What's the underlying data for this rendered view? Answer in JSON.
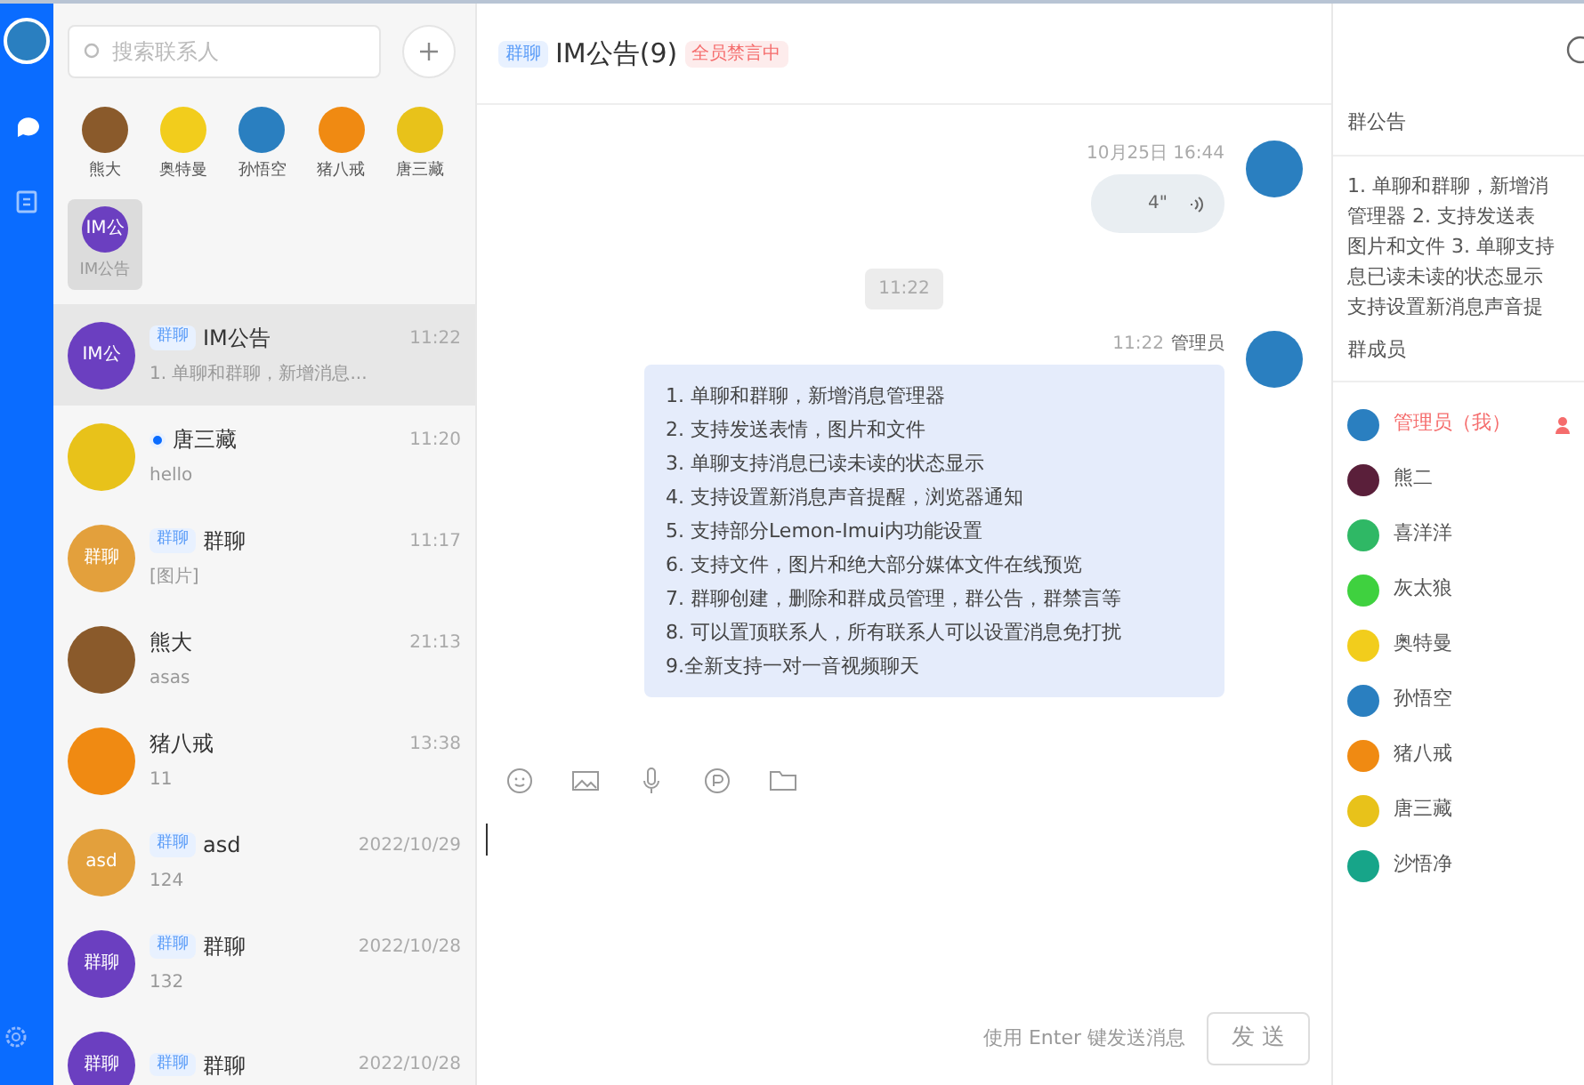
{
  "nav": {
    "items": [
      {
        "kind": "chat",
        "selected": true
      },
      {
        "kind": "contacts",
        "selected": false
      }
    ]
  },
  "search": {
    "placeholder": "搜索联系人"
  },
  "top_contacts": [
    {
      "name": "熊大",
      "color": "#8a5a2b",
      "selected": false
    },
    {
      "name": "奥特曼",
      "color": "#f2cd1c",
      "selected": false
    },
    {
      "name": "孙悟空",
      "color": "#2a7fc0",
      "selected": false
    },
    {
      "name": "猪八戒",
      "color": "#f08a12",
      "selected": false
    },
    {
      "name": "唐三藏",
      "color": "#e8c21a",
      "selected": false
    },
    {
      "name": "IM公告",
      "avatar_text": "IM公",
      "color": "#6b3fc0",
      "selected": true
    }
  ],
  "conversations": [
    {
      "tag": "群聊",
      "name": "IM公告",
      "time": "11:22",
      "preview": "1. 单聊和群聊，新增消息...",
      "avatar_text": "IM公",
      "color": "#6b3fc0",
      "dot": false,
      "selected": true
    },
    {
      "name": "唐三藏",
      "time": "11:20",
      "preview": "hello",
      "color": "#e8c21a",
      "dot": true,
      "selected": false
    },
    {
      "tag": "群聊",
      "name": "群聊",
      "time": "11:17",
      "preview": "[图片]",
      "avatar_text": "群聊",
      "color": "#e3a03c",
      "dot": false,
      "selected": false
    },
    {
      "name": "熊大",
      "time": "21:13",
      "preview": "asas",
      "color": "#8a5a2b",
      "dot": false,
      "selected": false
    },
    {
      "name": "猪八戒",
      "time": "13:38",
      "preview": "11",
      "color": "#f08a12",
      "dot": false,
      "selected": false
    },
    {
      "tag": "群聊",
      "name": "asd",
      "time": "2022/10/29",
      "preview": "124",
      "avatar_text": "asd",
      "color": "#e3a03c",
      "dot": false,
      "selected": false
    },
    {
      "tag": "群聊",
      "name": "群聊",
      "time": "2022/10/28",
      "preview": "132",
      "avatar_text": "群聊",
      "color": "#6b3fc0",
      "dot": false,
      "selected": false
    },
    {
      "tag": "群聊",
      "name": "群聊",
      "time": "2022/10/28",
      "avatar_text": "群聊",
      "color": "#6b3fc0",
      "dot": false,
      "selected": false
    }
  ],
  "header": {
    "tag": "群聊",
    "title": "IM公告(9)",
    "status": "全员禁言中"
  },
  "messages": [
    {
      "kind": "voice",
      "time": "10月25日 16:44",
      "duration": "4\""
    },
    {
      "kind": "divider",
      "time": "11:22"
    },
    {
      "kind": "text",
      "time": "11:22",
      "sender": "管理员",
      "lines": [
        "1. 单聊和群聊，新增消息管理器",
        "2. 支持发送表情，图片和文件",
        "3. 单聊支持消息已读未读的状态显示",
        "4. 支持设置新消息声音提醒，浏览器通知",
        "5. 支持部分Lemon-Imui内功能设置",
        "6. 支持文件，图片和绝大部分媒体文件在线预览",
        "7. 群聊创建，删除和群成员管理，群公告，群禁言等",
        "8. 可以置顶联系人，所有联系人可以设置消息免打扰",
        "9.全新支持一对一音视频聊天"
      ]
    }
  ],
  "toolbar": [
    {
      "kind": "emoji"
    },
    {
      "kind": "image"
    },
    {
      "kind": "mic"
    },
    {
      "kind": "record"
    },
    {
      "kind": "folder"
    }
  ],
  "composer": {
    "hint": "使用 Enter 键发送消息",
    "send": "发 送"
  },
  "notice": {
    "title": "群公告",
    "lines": [
      "1. 单聊和群聊，新增消",
      "管理器 2. 支持发送表",
      "图片和文件 3. 单聊支持",
      "息已读未读的状态显示",
      "支持设置新消息声音提"
    ]
  },
  "members": {
    "title": "群成员",
    "items": [
      {
        "name": "管理员（我）",
        "admin": true,
        "color": "#2a7fc0"
      },
      {
        "name": "熊二",
        "admin": false,
        "color": "#5a1f3a"
      },
      {
        "name": "喜洋洋",
        "admin": false,
        "color": "#2fb865"
      },
      {
        "name": "灰太狼",
        "admin": false,
        "color": "#3fd13f"
      },
      {
        "name": "奥特曼",
        "admin": false,
        "color": "#f2cd1c"
      },
      {
        "name": "孙悟空",
        "admin": false,
        "color": "#2a7fc0"
      },
      {
        "name": "猪八戒",
        "admin": false,
        "color": "#f08a12"
      },
      {
        "name": "唐三藏",
        "admin": false,
        "color": "#e8c21a"
      },
      {
        "name": "沙悟净",
        "admin": false,
        "color": "#17a589"
      }
    ]
  }
}
